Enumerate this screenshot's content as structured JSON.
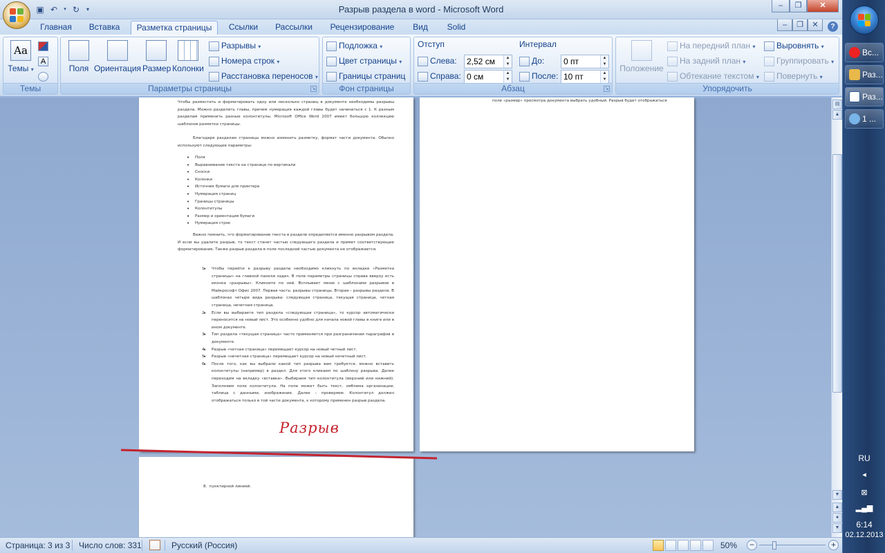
{
  "window": {
    "title": "Разрыв раздела в word - Microsoft Word"
  },
  "titlebar": {
    "minimize": "‒",
    "restore": "❐",
    "close": "✕",
    "ribbon_min": "‒",
    "ribbon_restore": "❐",
    "ribbon_close": "✕"
  },
  "tabs": [
    {
      "label": "Главная"
    },
    {
      "label": "Вставка"
    },
    {
      "label": "Разметка страницы"
    },
    {
      "label": "Ссылки"
    },
    {
      "label": "Рассылки"
    },
    {
      "label": "Рецензирование"
    },
    {
      "label": "Вид"
    },
    {
      "label": "Solid"
    }
  ],
  "active_tab": "Разметка страницы",
  "ribbon": {
    "themes": {
      "label": "Темы",
      "group": "Темы"
    },
    "page_setup": {
      "group": "Параметры страницы",
      "fields": "Поля",
      "orientation": "Ориентация",
      "size": "Размер",
      "columns": "Колонки",
      "breaks": "Разрывы",
      "line_numbers": "Номера строк",
      "hyphenation": "Расстановка переносов"
    },
    "page_background": {
      "group": "Фон страницы",
      "watermark": "Подложка",
      "page_color": "Цвет страницы",
      "page_borders": "Границы страниц"
    },
    "indent": {
      "title": "Отступ",
      "left_label": "Слева:",
      "left_value": "2,52 см",
      "right_label": "Справа:",
      "right_value": "0 см"
    },
    "spacing": {
      "title": "Интервал",
      "before_label": "До:",
      "before_value": "0 пт",
      "after_label": "После:",
      "after_value": "10 пт"
    },
    "paragraph_group": "Абзац",
    "arrange": {
      "group": "Упорядочить",
      "position": "Положение",
      "bring_front": "На передний план",
      "send_back": "На задний план",
      "text_wrap": "Обтекание текстом",
      "align": "Выровнять",
      "group_btn": "Группировать",
      "rotate": "Повернуть"
    }
  },
  "document": {
    "page1_intro": "Чтобы разместить и форматировать одну или несколько страниц в документе необходимы разрывы раздела. Можно разделить главы, причем нумерация каждой главы будет начинаться с 1. К разным разделам применить разные колонтитулы. Microsoft Office Word 2007 имеет большую коллекцию шаблонов разметки страницы.",
    "page1_para2": "Благодаря разделам страницы можно изменить разметку, формат части документа. Обычно используют следующие параметры:",
    "bullets": [
      "Поля",
      "Выравнивание текста на странице по вертикали",
      "Сноски",
      "Колонки",
      "Источник бумаги для принтера",
      "Нумерация страниц",
      "Границы страницы",
      "Колонтитулы",
      "Размер и ориентация бумаги",
      "Нумерация строк"
    ],
    "page1_para3": "Важно помнить, что форматирование текста в разделе определяется именно разрывом раздела. И если вы удалите разрыв, то текст станет частью следующего раздела и примет соответствующее форматирование. Также разрыв раздела в поле последней частью документа не отображается.",
    "numbered": [
      "Чтобы перейти к разрыву раздела необходимо кликнуть по вкладке «Разметка страницы» на главной панели задач. В поле параметры страницы справа вверху есть иконка «разрывы». Кликните по ней. Всплывает меню с шаблонами разрывов в Майкрософт Офис 2007. Первая часть: разрывы страницы. Вторая – разрывы раздела. В шаблонах четыре вида разрыва: следующая страница, текущая страница, четная страница, нечетная страница.",
      "Если вы выбираете тип раздела «следующая страница», то курсор автоматически переносится на новый лист. Это особенно удобно для начала новой главы в книге или в ином документе.",
      "Тип раздела «текущая страница» часто применяется при разграничении параграфов в документе.",
      "Разрыв «четная страница» перемещает курсор на новый четный лист.",
      "Разрыв «нечетная страница» перемещает курсор на новый нечетный лист.",
      "После того, как вы выбрали какой тип разрыва вам требуется, можно вставить колонтитулы (например) в раздел. Для этого кликаем по шаблону разрыва. Далее переходим на вкладку «вставка». Выбираем тип колонтитула (верхний или нижний). Заполняем поле колонтитула. На поле может быть текст, эмблема организации, таблица с данными, изображение. Далее – проверяем. Колонтитул должен отображаться только в той части документа, к которому применен разрыв раздела."
    ],
    "annotation": "Разрыв",
    "page2_text": "поле «размер» просмотра документа выбрать удобный. Разрыв будет отображаться",
    "page3_item_num": "8.",
    "page3_item": "пунктирной линией."
  },
  "statusbar": {
    "page": "Страница: 3 из 3",
    "words": "Число слов: 331",
    "language": "Русский (Россия)",
    "zoom": "50%",
    "zoom_minus": "−",
    "zoom_plus": "+"
  },
  "taskbar": {
    "items": [
      {
        "label": "Вс..."
      },
      {
        "label": "Раз..."
      },
      {
        "label": "Раз..."
      },
      {
        "label": "1 ..."
      }
    ],
    "lang": "RU",
    "time": "6:14",
    "date": "02.12.2013"
  },
  "colors": {
    "accent": "#15428b",
    "annotation": "#c4242f",
    "ribbon_bg": "#dbe7f5"
  }
}
